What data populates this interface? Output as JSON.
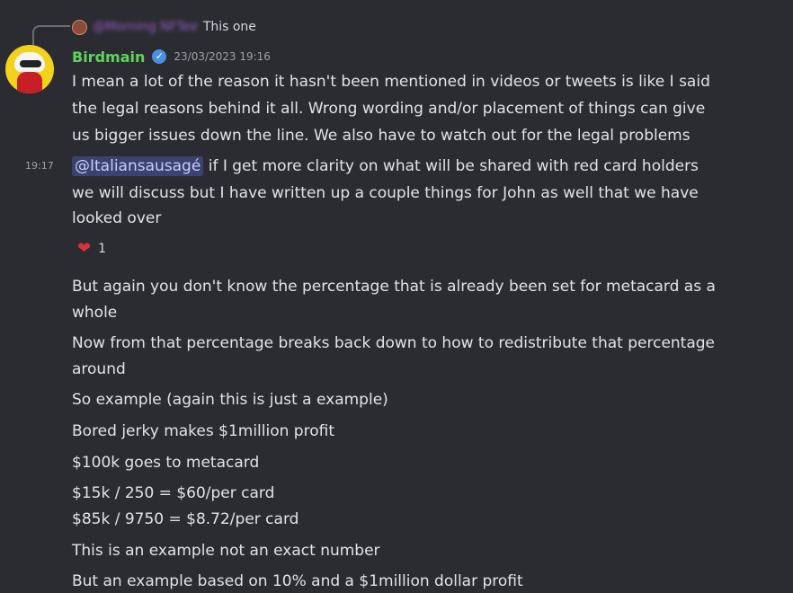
{
  "reply": {
    "user": "@Morning NFTee",
    "text": "This one"
  },
  "message": {
    "username": "Birdmain",
    "verified_glyph": "✓",
    "timestamp": "23/03/2023 19:16",
    "side_time": "19:17",
    "lines1": [
      "I mean a lot of the reason it hasn't been mentioned in videos or tweets is like I said",
      "the legal reasons behind it all. Wrong wording and/or placement of things can give",
      "us bigger issues down the line. We also have to watch out for the legal problems"
    ],
    "mention": "@Italiansausagé",
    "mention_tail": " if I get more clarity on what will be shared with red card holders",
    "lines2": [
      "we will discuss but I have written up a couple things for John as well that we have",
      "looked over"
    ],
    "reaction": {
      "icon": "heart-icon",
      "count": "1"
    },
    "followups": [
      "But again you don't know the percentage that is already been set for metacard as a",
      "whole",
      "Now from that percentage breaks back down to how to redistribute that percentage",
      "around",
      "So example (again this is just a example)",
      "Bored jerky makes $1million profit",
      "$100k goes to metacard",
      "$15k / 250 = $60/per card",
      "$85k / 9750 = $8.72/per card",
      "This is an example not an exact number",
      "But an example based on 10% and a $1million dollar profit"
    ]
  }
}
